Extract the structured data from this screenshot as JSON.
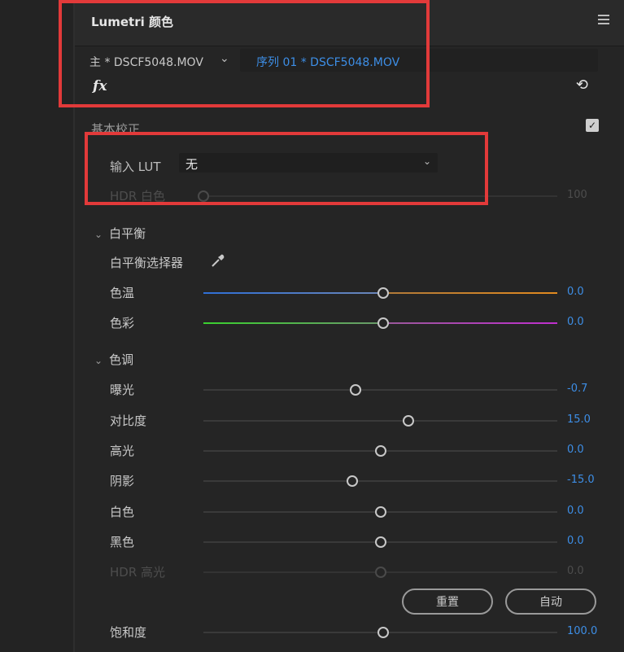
{
  "panel": {
    "title": "Lumetri 颜色",
    "master_clip": "主 * DSCF5048.MOV",
    "sequence_clip": "序列 01 * DSCF5048.MOV"
  },
  "basic": {
    "section_title": "基本校正",
    "lut_label": "输入 LUT",
    "lut_value": "无",
    "hdr_white_label": "HDR 白色",
    "hdr_white_value": "100"
  },
  "white_balance": {
    "title": "白平衡",
    "picker_label": "白平衡选择器",
    "temperature_label": "色温",
    "temperature_value": "0.0",
    "tint_label": "色彩",
    "tint_value": "0.0"
  },
  "tone": {
    "title": "色调",
    "rows": [
      {
        "label": "曝光",
        "value": "-0.7",
        "fraction": 0.43
      },
      {
        "label": "对比度",
        "value": "15.0",
        "fraction": 0.58
      },
      {
        "label": "高光",
        "value": "0.0",
        "fraction": 0.5
      },
      {
        "label": "阴影",
        "value": "-15.0",
        "fraction": 0.42
      },
      {
        "label": "白色",
        "value": "0.0",
        "fraction": 0.5
      },
      {
        "label": "黑色",
        "value": "0.0",
        "fraction": 0.5
      },
      {
        "label": "HDR 高光",
        "value": "0.0",
        "fraction": 0.5
      }
    ],
    "reset_label": "重置",
    "auto_label": "自动",
    "saturation_label": "饱和度",
    "saturation_value": "100.0"
  },
  "colors": {
    "accent": "#3d8ee6",
    "annotation": "#e23a3a",
    "panel_bg": "#252525"
  },
  "icons": {
    "menu": "hamburger-icon",
    "fx": "fx-icon",
    "reset": "reset-icon",
    "eyedropper": "eyedropper-icon",
    "checkbox": "checkmark-icon"
  }
}
